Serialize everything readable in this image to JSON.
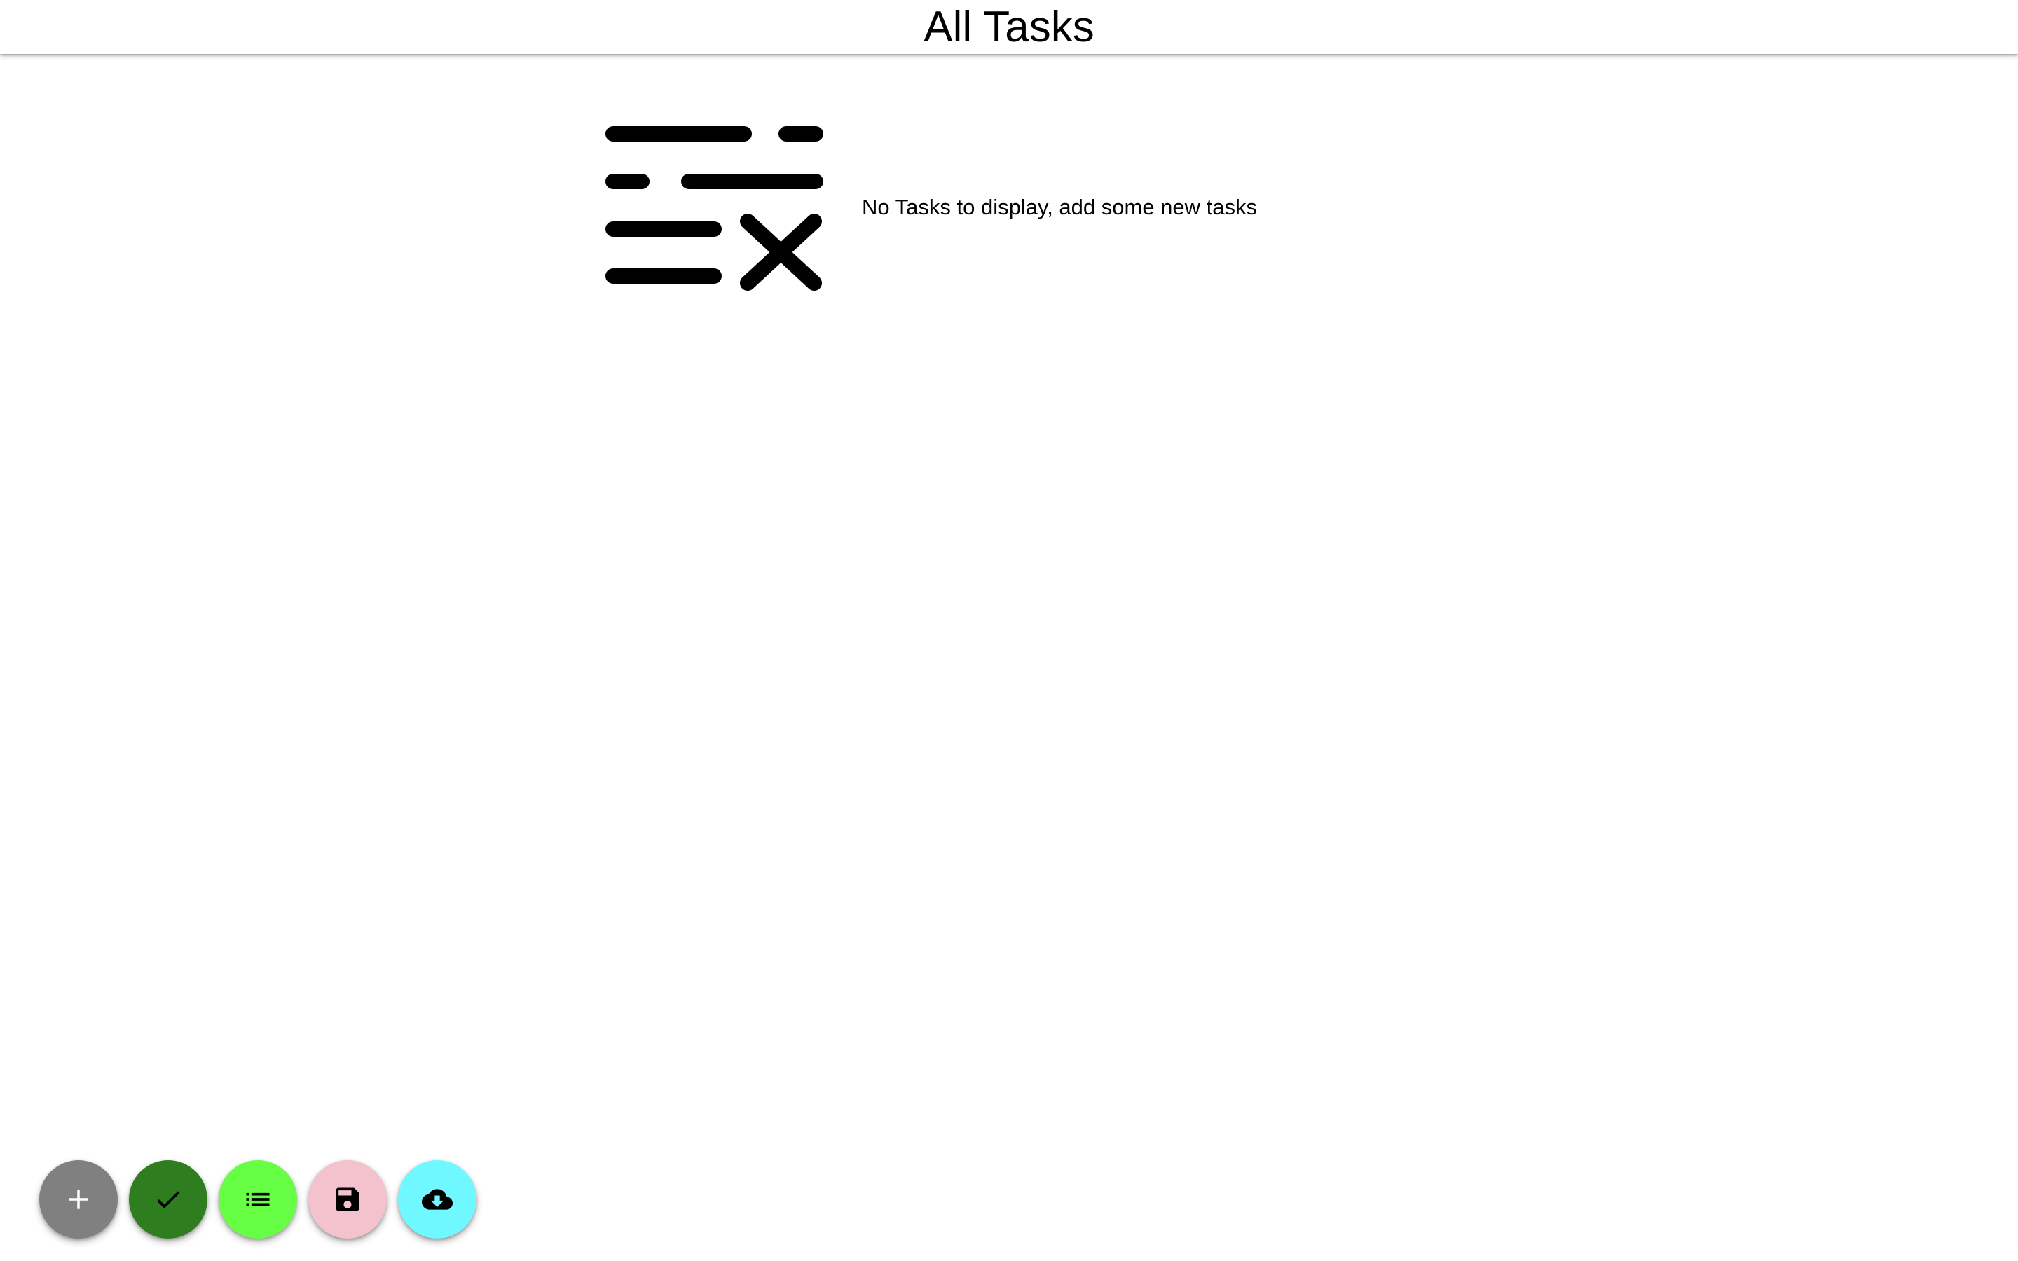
{
  "header": {
    "title": "All Tasks"
  },
  "empty_state": {
    "icon": "clear-list-icon",
    "message": "No Tasks to display, add some new tasks"
  },
  "fab_buttons": [
    {
      "name": "add-task-button",
      "icon": "plus-icon",
      "background": "#808080",
      "icon_color": "#ffffff"
    },
    {
      "name": "completed-tasks-button",
      "icon": "check-icon",
      "background": "#2e7d1f",
      "icon_color": "#000000"
    },
    {
      "name": "all-tasks-button",
      "icon": "list-icon",
      "background": "#66ff44",
      "icon_color": "#000000"
    },
    {
      "name": "save-button",
      "icon": "floppy-disk-icon",
      "background": "#f4c2cc",
      "icon_color": "#000000"
    },
    {
      "name": "cloud-download-button",
      "icon": "cloud-download-icon",
      "background": "#6ff8ff",
      "icon_color": "#000000"
    }
  ]
}
